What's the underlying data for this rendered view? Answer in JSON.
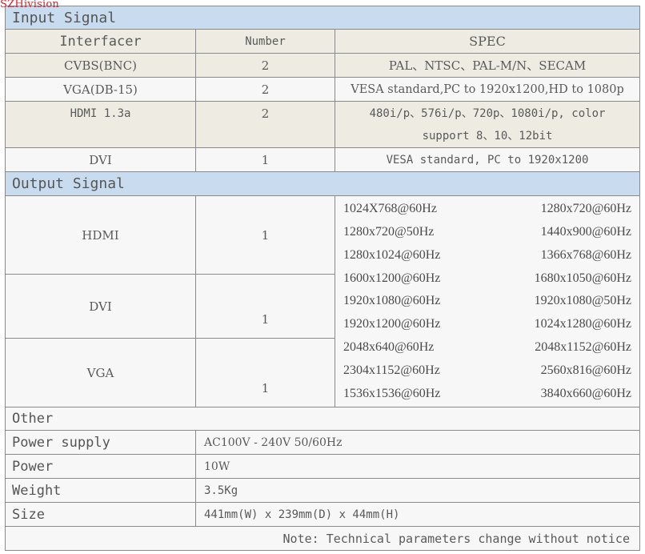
{
  "watermark": "SZHivision",
  "input_section": {
    "title": "Input Signal",
    "headers": [
      "Interfacer",
      "Number",
      "SPEC"
    ],
    "rows": [
      {
        "interface": "CVBS(BNC)",
        "number": "2",
        "spec": "PAL、NTSC、PAL-M/N、SECAM"
      },
      {
        "interface": "VGA(DB-15)",
        "number": "2",
        "spec": "VESA standard,PC to 1920x1200,HD to 1080p"
      },
      {
        "interface": "HDMI 1.3a",
        "number": "2",
        "spec_line1": "480i/p、576i/p、720p、1080i/p, color",
        "spec_line2": "support 8、10、12bit"
      },
      {
        "interface": "DVI",
        "number": "1",
        "spec": "VESA standard, PC to 1920x1200"
      }
    ]
  },
  "output_section": {
    "title": "Output Signal",
    "rows": [
      {
        "interface": "HDMI",
        "number": "1"
      },
      {
        "interface": "DVI",
        "number": "1"
      },
      {
        "interface": "VGA",
        "number": "1"
      }
    ],
    "resolutions": [
      [
        "1024X768@60Hz",
        "1280x720@60Hz"
      ],
      [
        "1280x720@50Hz",
        "1440x900@60Hz"
      ],
      [
        "1280x1024@60Hz",
        "1366x768@60Hz"
      ],
      [
        "1600x1200@60Hz",
        "1680x1050@60Hz"
      ],
      [
        "1920x1080@60Hz",
        "1920x1080@50Hz"
      ],
      [
        "1920x1200@60Hz",
        "1024x1280@60Hz"
      ],
      [
        "2048x640@60Hz",
        "2048x1152@60Hz"
      ],
      [
        "2304x1152@60Hz",
        "2560x816@60Hz"
      ],
      [
        "1536x1536@60Hz",
        "3840x660@60Hz"
      ]
    ]
  },
  "other_section": {
    "title": "Other",
    "rows": [
      {
        "label": "Power supply",
        "value": "AC100V - 240V  50/60Hz"
      },
      {
        "label": "Power",
        "value": "10W"
      },
      {
        "label": "Weight",
        "value": "3.5Kg"
      },
      {
        "label": "Size",
        "value": "441mm(W) x 239mm(D) x 44mm(H)"
      }
    ]
  },
  "note": "Note: Technical parameters change without notice"
}
